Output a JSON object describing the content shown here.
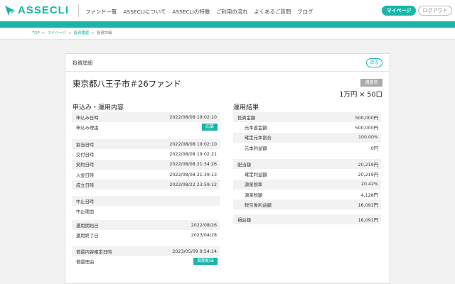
{
  "header": {
    "logo_text": "ASSECLI",
    "nav": [
      "ファンド一覧",
      "ASSECLIについて",
      "ASSECLIの特徴",
      "ご利用の流れ",
      "よくあるご質問",
      "ブログ"
    ],
    "mypage_label": "マイページ",
    "logout_label": "ログアウト"
  },
  "breadcrumb": {
    "top": "TOP",
    "mypage": "マイページ",
    "history": "投資履歴",
    "current": "投資詳細"
  },
  "colors": {
    "accent": "#1ab5a8",
    "badge_gray": "#aaaaaa"
  },
  "card": {
    "title": "投資詳細",
    "back_label": "戻る",
    "fund_name": "東京都八王子市＃26ファンド",
    "status": "償還済",
    "units": "1万円 × 50口"
  },
  "application": {
    "section_title": "申込み・運用内容",
    "g1": [
      {
        "label": "申込み日時",
        "value": "2022/08/08 19:02:10",
        "shade": true
      },
      {
        "label": "申込み理由",
        "tag": "応募",
        "shade": false
      }
    ],
    "g2": [
      {
        "label": "割当日時",
        "value": "2022/08/08 19:02:10",
        "shade": true
      },
      {
        "label": "交付日時",
        "value": "2022/08/08 19:02:21",
        "shade": false
      },
      {
        "label": "契約日時",
        "value": "2022/08/08 21:34:26",
        "shade": true
      },
      {
        "label": "入金日時",
        "value": "2022/08/08 21:39:13",
        "shade": false
      },
      {
        "label": "成立日時",
        "value": "2022/08/22 23:59:12",
        "shade": true
      }
    ],
    "g3": [
      {
        "label": "中止日時",
        "value": "",
        "shade": true
      },
      {
        "label": "中止理由",
        "value": "",
        "shade": false
      }
    ],
    "g4": [
      {
        "label": "運用開始日",
        "value": "2022/08/26",
        "shade": true
      },
      {
        "label": "運用終了日",
        "value": "2023/04/28",
        "shade": false
      }
    ],
    "g5": [
      {
        "label": "償還内容確定日時",
        "value": "2023/05/09 9:54:14",
        "shade": true
      },
      {
        "label": "償還理由",
        "tag": "満期配当",
        "shade": false
      }
    ]
  },
  "results": {
    "section_title": "運用結果",
    "g1": [
      {
        "label": "投資金額",
        "value": "500,000円",
        "shade": true,
        "indent": false
      },
      {
        "label": "元本返金額",
        "value": "500,000円",
        "shade": false,
        "indent": true
      },
      {
        "label": "確定元本割合",
        "value": "100.00%",
        "shade": true,
        "indent": true
      },
      {
        "label": "元本利益額",
        "value": "0円",
        "shade": false,
        "indent": true
      }
    ],
    "g2": [
      {
        "label": "配当額",
        "value": "20,219円",
        "shade": true,
        "indent": false
      },
      {
        "label": "確定利益額",
        "value": "20,219円",
        "shade": false,
        "indent": true
      },
      {
        "label": "源泉税率",
        "value": "20.42%",
        "shade": true,
        "indent": true
      },
      {
        "label": "源泉税額",
        "value": "4,128円",
        "shade": false,
        "indent": true
      },
      {
        "label": "税引後利益額",
        "value": "16,091円",
        "shade": true,
        "indent": true
      }
    ],
    "g3": [
      {
        "label": "損益額",
        "value": "16,091円",
        "shade": true,
        "indent": false
      }
    ]
  }
}
